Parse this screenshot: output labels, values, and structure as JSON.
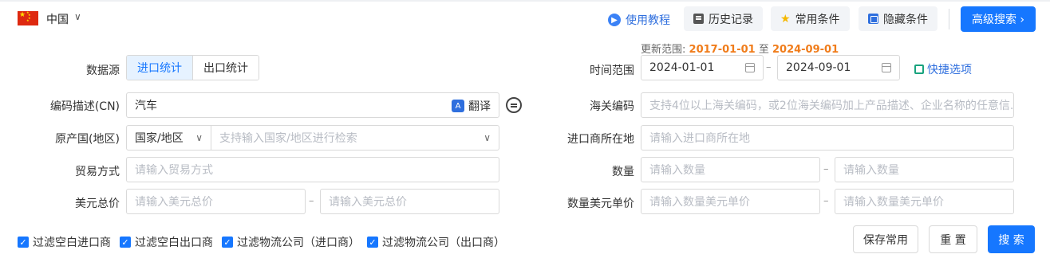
{
  "header": {
    "country": "中国",
    "help_link": "使用教程",
    "history_button": "历史记录",
    "favorites_button": "常用条件",
    "hide_button": "隐藏条件",
    "advanced_search_button": "高级搜索 ›"
  },
  "range_note": {
    "label": "更新范围:",
    "start": "2017-01-01",
    "sep": "至",
    "end": "2024-09-01"
  },
  "form": {
    "data_source": {
      "label": "数据源",
      "options": [
        "进口统计",
        "出口统计"
      ],
      "selected": "进口统计"
    },
    "time_range": {
      "label": "时间范围",
      "start": "2024-01-01",
      "end": "2024-09-01",
      "dash": "–",
      "quick_options": "快捷选项"
    },
    "code_desc": {
      "label": "编码描述(CN)",
      "value": "汽车",
      "translate": "翻译"
    },
    "customs_code": {
      "label": "海关编码",
      "placeholder": "支持4位以上海关编码，或2位海关编码加上产品描述、企业名称的任意信..."
    },
    "origin": {
      "label": "原产国(地区)",
      "select": "国家/地区",
      "placeholder": "支持输入国家/地区进行检索"
    },
    "importer_location": {
      "label": "进口商所在地",
      "placeholder": "请输入进口商所在地"
    },
    "trade_mode": {
      "label": "贸易方式",
      "placeholder": "请输入贸易方式"
    },
    "quantity": {
      "label": "数量",
      "placeholder_min": "请输入数量",
      "placeholder_max": "请输入数量",
      "dash": "–"
    },
    "usd_total": {
      "label": "美元总价",
      "placeholder_min": "请输入美元总价",
      "placeholder_max": "请输入美元总价",
      "dash": "–"
    },
    "qty_usd_unit": {
      "label": "数量美元单价",
      "placeholder_min": "请输入数量美元单价",
      "placeholder_max": "请输入数量美元单价",
      "dash": "–"
    }
  },
  "filters": [
    "过滤空白进口商",
    "过滤空白出口商",
    "过滤物流公司（进口商）",
    "过滤物流公司（出口商）"
  ],
  "actions": {
    "save": "保存常用",
    "reset": "重 置",
    "search": "搜 索"
  },
  "colors": {
    "primary": "#1677ff",
    "highlight": "#f07c1a"
  }
}
